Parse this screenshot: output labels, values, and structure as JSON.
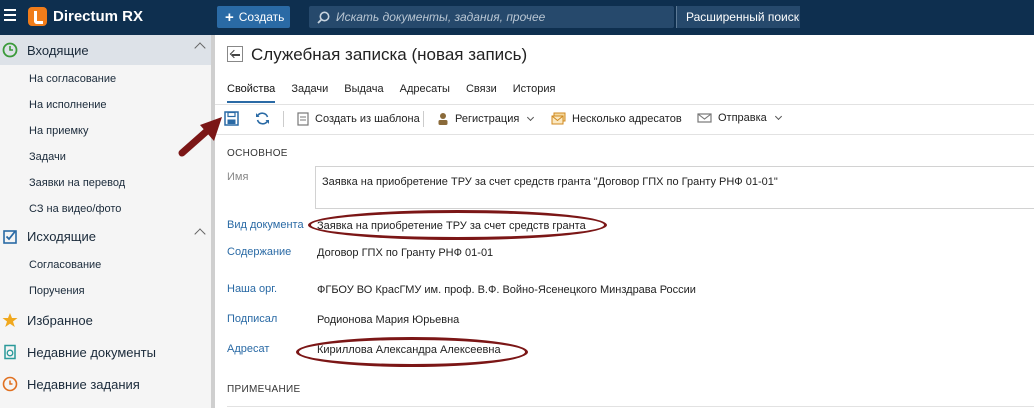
{
  "app": {
    "title": "Directum RX",
    "create_label": "Создать",
    "search_placeholder": "Искать документы, задания, прочее",
    "advanced_search": "Расширенный поиск"
  },
  "sidebar": {
    "groups": [
      {
        "label": "Входящие",
        "icon": "inbox-clock-icon",
        "items": [
          "На согласование",
          "На исполнение",
          "На приемку",
          "Задачи",
          "Заявки на перевод",
          "СЗ на видео/фото"
        ]
      },
      {
        "label": "Исходящие",
        "icon": "outbox-check-icon",
        "items": [
          "Согласование",
          "Поручения"
        ]
      },
      {
        "label": "Избранное",
        "icon": "star-icon",
        "items": []
      },
      {
        "label": "Недавние документы",
        "icon": "recent-documents-icon",
        "items": []
      },
      {
        "label": "Недавние задания",
        "icon": "recent-tasks-icon",
        "items": []
      }
    ]
  },
  "document": {
    "title": "Служебная записка (новая запись)",
    "tabs": [
      "Свойства",
      "Задачи",
      "Выдача",
      "Адресаты",
      "Связи",
      "История"
    ],
    "active_tab": "Свойства"
  },
  "toolbar": {
    "create_from_template": "Создать из шаблона",
    "registration": "Регистрация",
    "multiple_recipients": "Несколько адресатов",
    "sending": "Отправка"
  },
  "form": {
    "section_main": "ОСНОВНОЕ",
    "section_note": "ПРИМЕЧАНИЕ",
    "fields": {
      "name": {
        "label": "Имя",
        "value": "Заявка на приобретение ТРУ за счет средств гранта \"Договор ГПХ по Гранту РНФ 01-01\""
      },
      "doc_kind": {
        "label": "Вид документа",
        "value": "Заявка на приобретение ТРУ за счет средств гранта"
      },
      "subject": {
        "label": "Содержание",
        "value": "Договор ГПХ по Гранту РНФ 01-01"
      },
      "our_org": {
        "label": "Наша орг.",
        "value": "ФГБОУ ВО КрасГМУ им. проф. В.Ф. Войно-Ясенецкого Минздрава России"
      },
      "signed_by": {
        "label": "Подписал",
        "value": "Родионова Мария Юрьевна"
      },
      "addressee": {
        "label": "Адресат",
        "value": "Кириллова Александра Алексеевна"
      }
    }
  },
  "colors": {
    "topbar": "#0e2f4f",
    "accent": "#2a6aa5",
    "annotation": "#7b1616",
    "logo": "#f07c1a"
  }
}
